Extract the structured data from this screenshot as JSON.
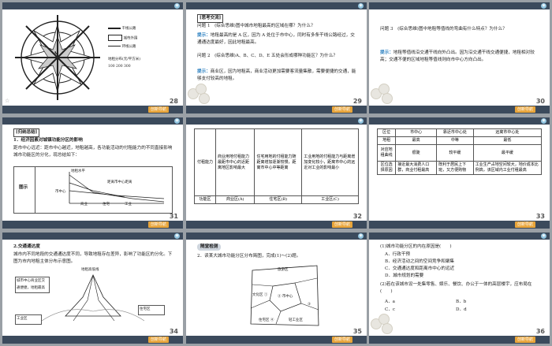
{
  "slides": [
    {
      "num": "28",
      "legend": [
        "干线公路",
        "城市外围",
        "环线公路",
        "地租分布(元/平方米)",
        "100 200 300"
      ],
      "center_label": "A",
      "next": "创新导航"
    },
    {
      "num": "29",
      "tag": "[思考交流]",
      "q1": "问题 1　(综合思维)图中城市地租最高的区域在哪？为什么？",
      "hint": "提示：",
      "a1": "地租最高的是 A 区，因为 A 处位于市中心，同时有多条干线公路经过，交通通达度最好，因此地租最高。",
      "q2": "问题 2　(综合思维)A、B、C、D、E 五处会形成哪种功能区？为什么？",
      "a2": "商业区，因为地租高，商业活动更加需要客流量集散，需要便捷的交通，能够支付较高的地租。",
      "next": "创新导航"
    },
    {
      "num": "30",
      "q3": "问题 3　(综合思维)图中地租等值线的弯曲有什么特点？为什么？",
      "hint": "提示：",
      "a3": "地租等值线沿交通干线向外凸出。因为沿交通干线交通便捷，地租相对较高；交通不便的区域地租等值线则向市中心方向凸出。",
      "next": "创新导航"
    },
    {
      "num": "31",
      "section": "[归纳总结]",
      "h1": "1．经济因素对城镇功能分区的影响",
      "body": "距市中心远近：距市中心越近，地租越高，各功能活动的付租能力的不同直接影响城市功能区的分化，现总结如下：",
      "label": "图示",
      "fig_labels": [
        "地租水平",
        "市中心",
        "距离市中心距离",
        "商业",
        "住宅",
        "工业"
      ],
      "next": "创新导航"
    },
    {
      "num": "32",
      "rows": [
        [
          "付租能力",
          "商业用地付租能力最距市中心的近距离地区影响最大",
          "住宅用地的付租能力随距离增加逐渐较慢，距离市中心中等距离",
          "工业用地的付租能力与距离增加变化较小，距离市中心的远近对工业的影响最小"
        ],
        [
          "功能区",
          "商业区(A)",
          "住宅区(B)",
          "工业区(C)"
        ]
      ],
      "next": "创新导航"
    },
    {
      "num": "33",
      "header": [
        "区位",
        "市中心",
        "靠近市中心处",
        "远离市中心处"
      ],
      "rows": [
        [
          "地租",
          "最高",
          "中等",
          "最低"
        ],
        [
          "对应地租曲线",
          "很陡",
          "较平缓",
          "最平缓"
        ],
        [
          "区位选择原因",
          "接近最大消费人口群，商业付租最高",
          "既利于居民上下班，又方便购物",
          "工业生产占地空间较大，地价成本比例高，该区域内工业付租最高"
        ]
      ],
      "next": "创新导航"
    },
    {
      "num": "34",
      "h": "2.交通通达度",
      "body": "城市内不同地段的交通通达度不同，导致地租存在差异，影响了功能区的分化。下图为市内地租主体分布示意图。",
      "fig_title": "地租高低线",
      "boxes": [
        "城市中心商业区交通便捷，地租最高",
        "工业区",
        "住宅区"
      ],
      "next": "创新导航"
    },
    {
      "num": "35",
      "tag": "随堂检测",
      "q": "2．读某大城市功能分区分布简图，完成(1)～(2)题。",
      "areas": [
        "旅游区",
        "文化区 ①",
        "② 市中心",
        "住宅区 ④",
        "轻工业区",
        "③"
      ],
      "next": "创新导航"
    },
    {
      "num": "36",
      "q1": "(1)城市功能分区的内在原因是(　　)",
      "opts1": [
        "A．行政干预",
        "B．经济活动之间的空间竞争和聚集",
        "C．交通通达度和距离市中心的远近",
        "D．城市规划的需要"
      ],
      "q2": "(2)若在该城市设一处集零售、娱乐、餐饮、办公于一体的高层楼宇，应布局在(　　)",
      "opts2": [
        "A．a",
        "B．b",
        "C．c",
        "D．d"
      ],
      "next": "创新导航"
    }
  ]
}
